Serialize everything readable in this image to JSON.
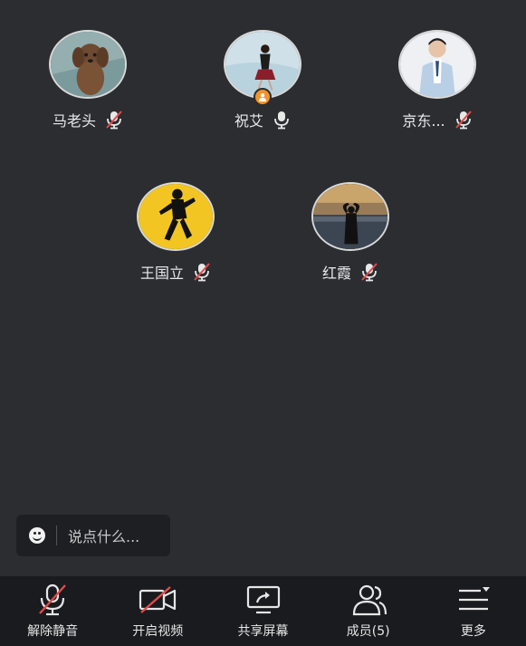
{
  "participants": [
    {
      "name": "马老头",
      "mic": "muted"
    },
    {
      "name": "祝艾",
      "mic": "on",
      "host": true
    },
    {
      "name": "京东...",
      "mic": "muted"
    },
    {
      "name": "王国立",
      "mic": "muted"
    },
    {
      "name": "红霞",
      "mic": "muted"
    }
  ],
  "chat": {
    "placeholder": "说点什么...",
    "emoji_icon": "smile-icon"
  },
  "toolbar": {
    "unmute_label": "解除静音",
    "video_label": "开启视频",
    "share_label": "共享屏幕",
    "members_label": "成员(5)",
    "more_label": "更多"
  },
  "colors": {
    "background": "#2b2d31",
    "toolbar": "#1a1b1e",
    "mute_slash": "#e24a4a",
    "host_badge": "#f39426"
  }
}
